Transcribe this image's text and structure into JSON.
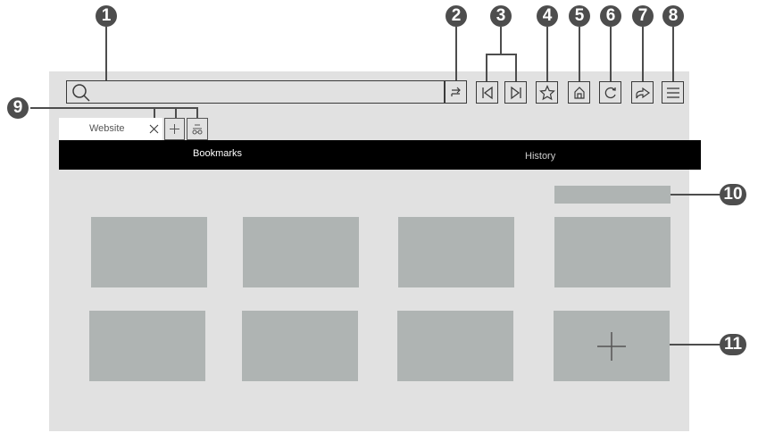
{
  "address_bar": {
    "placeholder": ""
  },
  "tabs": {
    "active_tab_label": "Website"
  },
  "nav": {
    "bookmarks_label": "Bookmarks",
    "history_label": "History"
  },
  "callouts": [
    "1",
    "2",
    "3",
    "4",
    "5",
    "6",
    "7",
    "8",
    "9",
    "10",
    "11"
  ],
  "colors": {
    "browser_bg": "#e1e1e1",
    "nav_bar": "#000000",
    "tile": "#afb4b3",
    "callout": "#4d4d4d"
  },
  "icons": [
    "search-icon",
    "go-icon",
    "back-icon",
    "forward-icon",
    "star-icon",
    "home-icon",
    "refresh-icon",
    "share-icon",
    "menu-icon",
    "close-icon",
    "plus-icon",
    "incognito-icon"
  ]
}
